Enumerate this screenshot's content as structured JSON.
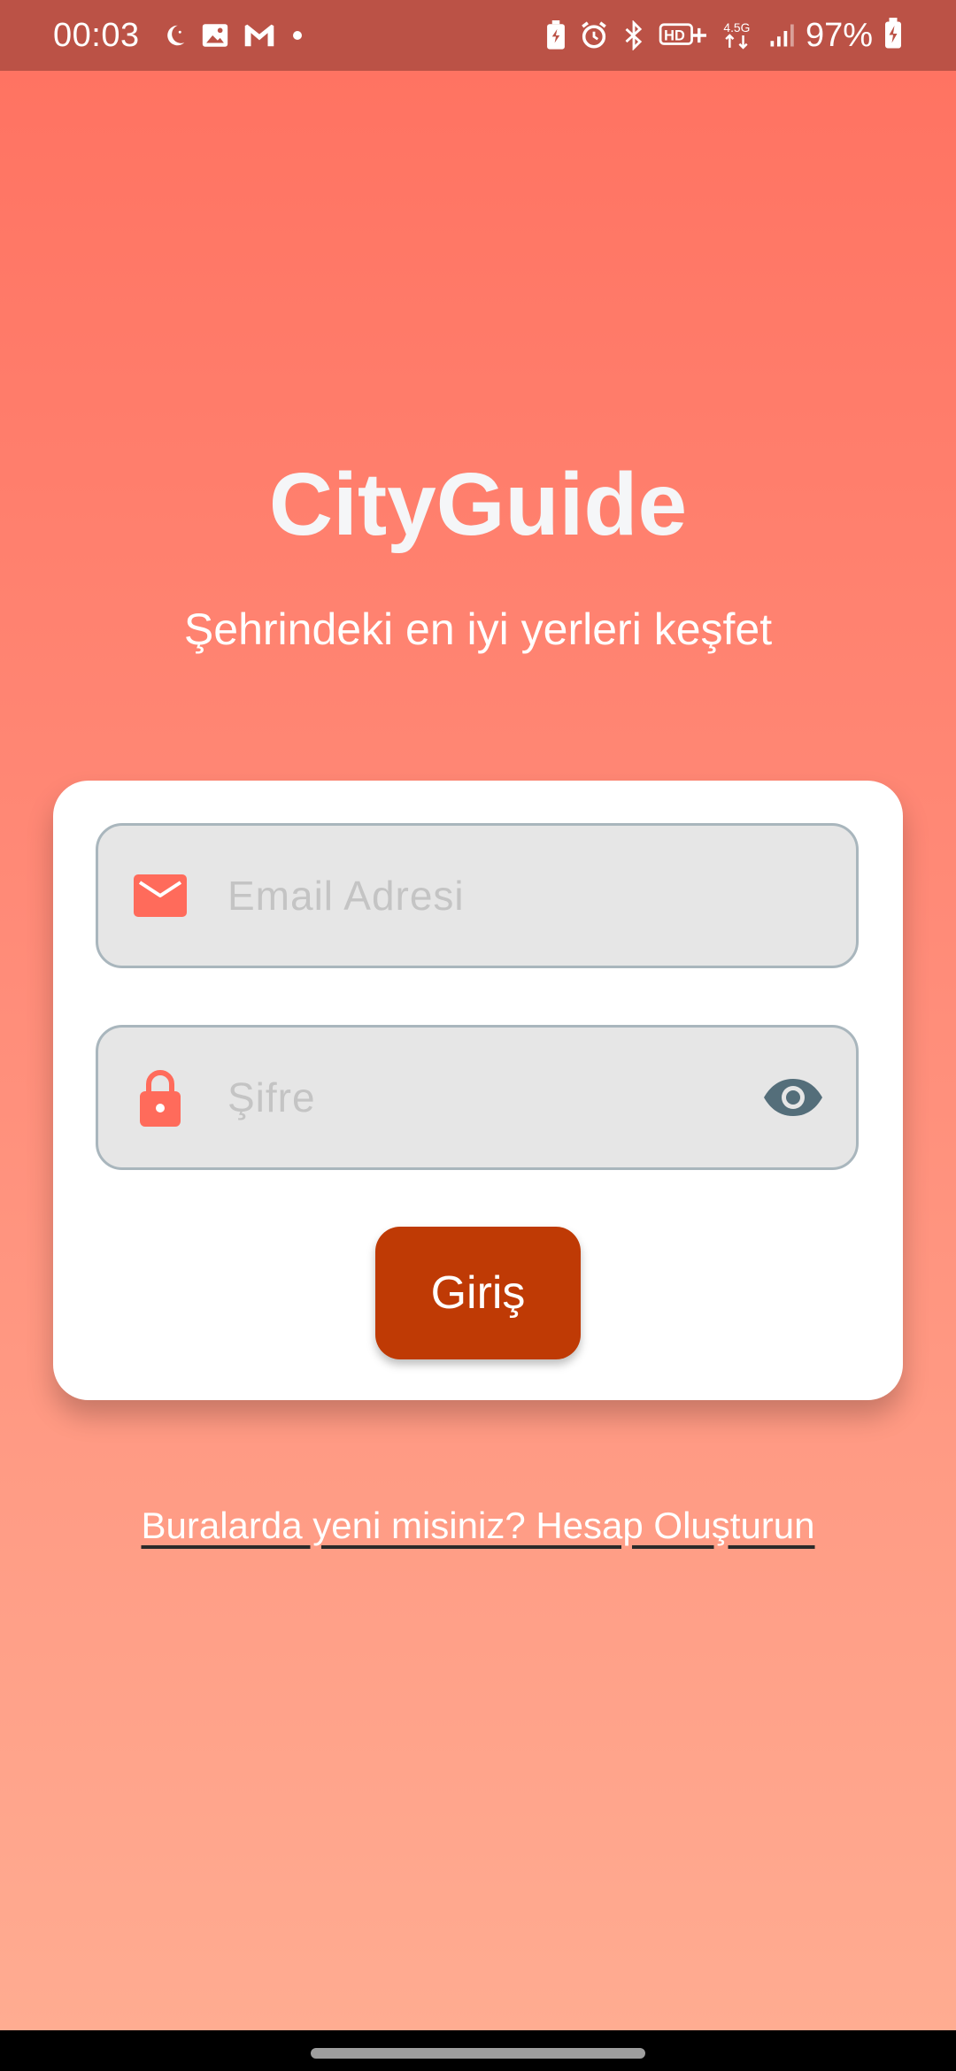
{
  "status_bar": {
    "time": "00:03",
    "battery_percent": "97%",
    "network_label": "4.5G",
    "left_icons": [
      "moon-icon",
      "image-icon",
      "gmail-icon",
      "dot-icon"
    ],
    "right_icons": [
      "battery-saver-icon",
      "alarm-icon",
      "bluetooth-icon",
      "hd-voice-icon",
      "network-4-5g-icon",
      "signal-icon",
      "battery-charging-icon"
    ]
  },
  "app": {
    "title": "CityGuide",
    "subtitle": "Şehrindeki en iyi yerleri keşfet"
  },
  "login_form": {
    "email_placeholder": "Email Adresi",
    "email_value": "",
    "password_placeholder": "Şifre",
    "password_value": "",
    "submit_label": "Giriş"
  },
  "signup_link": "Buralarda yeni misiniz? Hesap Oluşturun",
  "colors": {
    "status_bar_bg": "#bb5246",
    "gradient_top": "#ff7160",
    "gradient_bottom": "#ffad92",
    "accent_icon": "#ff6b5b",
    "button_bg": "#bf3a05",
    "eye_icon": "#546e7a"
  }
}
